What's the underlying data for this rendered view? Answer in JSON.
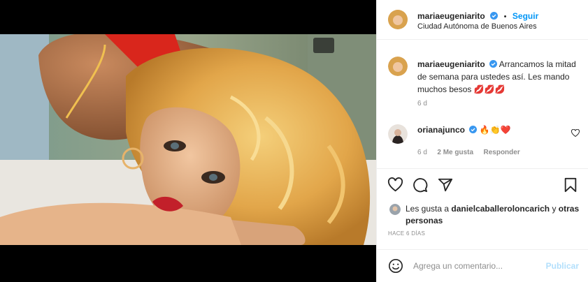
{
  "post": {
    "author": "mariaeugeniarito",
    "follow_label": "Seguir",
    "dot": "•",
    "location": "Ciudad Autónoma de Buenos Aires",
    "caption_user": "mariaeugeniarito",
    "caption_text": "Arrancamos la mitad de semana para ustedes así. Les mando muchos besos 💋💋💋",
    "caption_age": "6 d"
  },
  "comment": {
    "user": "orianajunco",
    "text": "🔥👏❤️",
    "age": "6 d",
    "likes": "2 Me gusta",
    "reply": "Responder"
  },
  "likes": {
    "prefix": "Les gusta a",
    "user": "danielcaballeroloncarich",
    "suffix": "y",
    "others": "otras personas"
  },
  "timestamp": "HACE 6 DÍAS",
  "composer": {
    "placeholder": "Agrega un comentario...",
    "publish_label": "Publicar"
  },
  "colors": {
    "accent": "#0095f6",
    "verified": "#3897f0",
    "muted": "#8e8e8e",
    "publish_disabled": "#b2dffc"
  },
  "icons": [
    "heart-icon",
    "comment-icon",
    "share-icon",
    "bookmark-icon",
    "verified-badge-icon",
    "emoji-icon",
    "small-heart-icon"
  ]
}
